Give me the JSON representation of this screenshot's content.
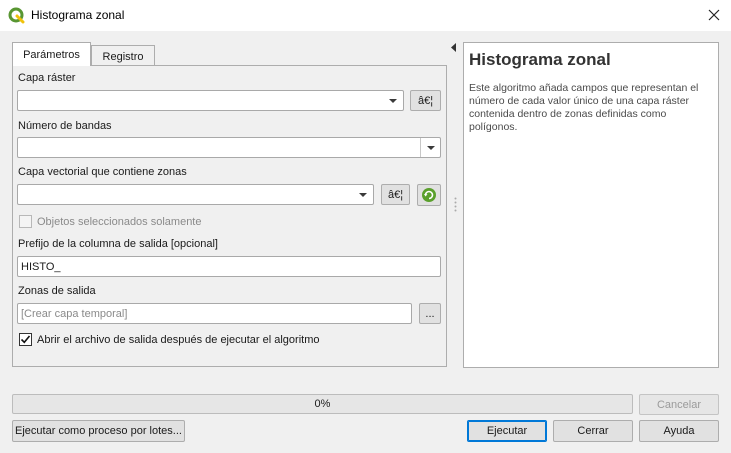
{
  "window": {
    "title": "Histograma zonal",
    "icon": "qgis-logo-icon",
    "close_icon": "close-icon"
  },
  "tabs": [
    {
      "label": "Parámetros",
      "active": true
    },
    {
      "label": "Registro",
      "active": false
    }
  ],
  "params": {
    "raster_layer": {
      "label": "Capa ráster",
      "value": "",
      "ellipsis": "â€¦"
    },
    "band_number": {
      "label": "Número de bandas",
      "value": ""
    },
    "vector_layer": {
      "label": "Capa vectorial que contiene zonas",
      "value": "",
      "ellipsis": "â€¦"
    },
    "selected_only": {
      "label": "Objetos seleccionados solamente",
      "checked": false,
      "enabled": false
    },
    "prefix": {
      "label": "Prefijo de la columna de salida [opcional]",
      "value": "HISTO_"
    },
    "output": {
      "label": "Zonas de salida",
      "placeholder": "[Crear capa temporal]",
      "browse": "..."
    },
    "open_after": {
      "label": "Abrir el archivo de salida después de ejecutar el algoritmo",
      "checked": true
    }
  },
  "help": {
    "title": "Histograma zonal",
    "body": "Este algoritmo añada campos que representan el número de cada valor único de una capa ráster contenida dentro de zonas definidas como polígonos."
  },
  "progress": {
    "value": 0,
    "text": "0%"
  },
  "buttons": {
    "cancel": "Cancelar",
    "batch": "Ejecutar como proceso por lotes...",
    "run": "Ejecutar",
    "close": "Cerrar",
    "help": "Ayuda"
  },
  "colors": {
    "accent": "#0078d7",
    "qgis_green": "#589632",
    "qgis_yellow": "#f0c20c"
  }
}
